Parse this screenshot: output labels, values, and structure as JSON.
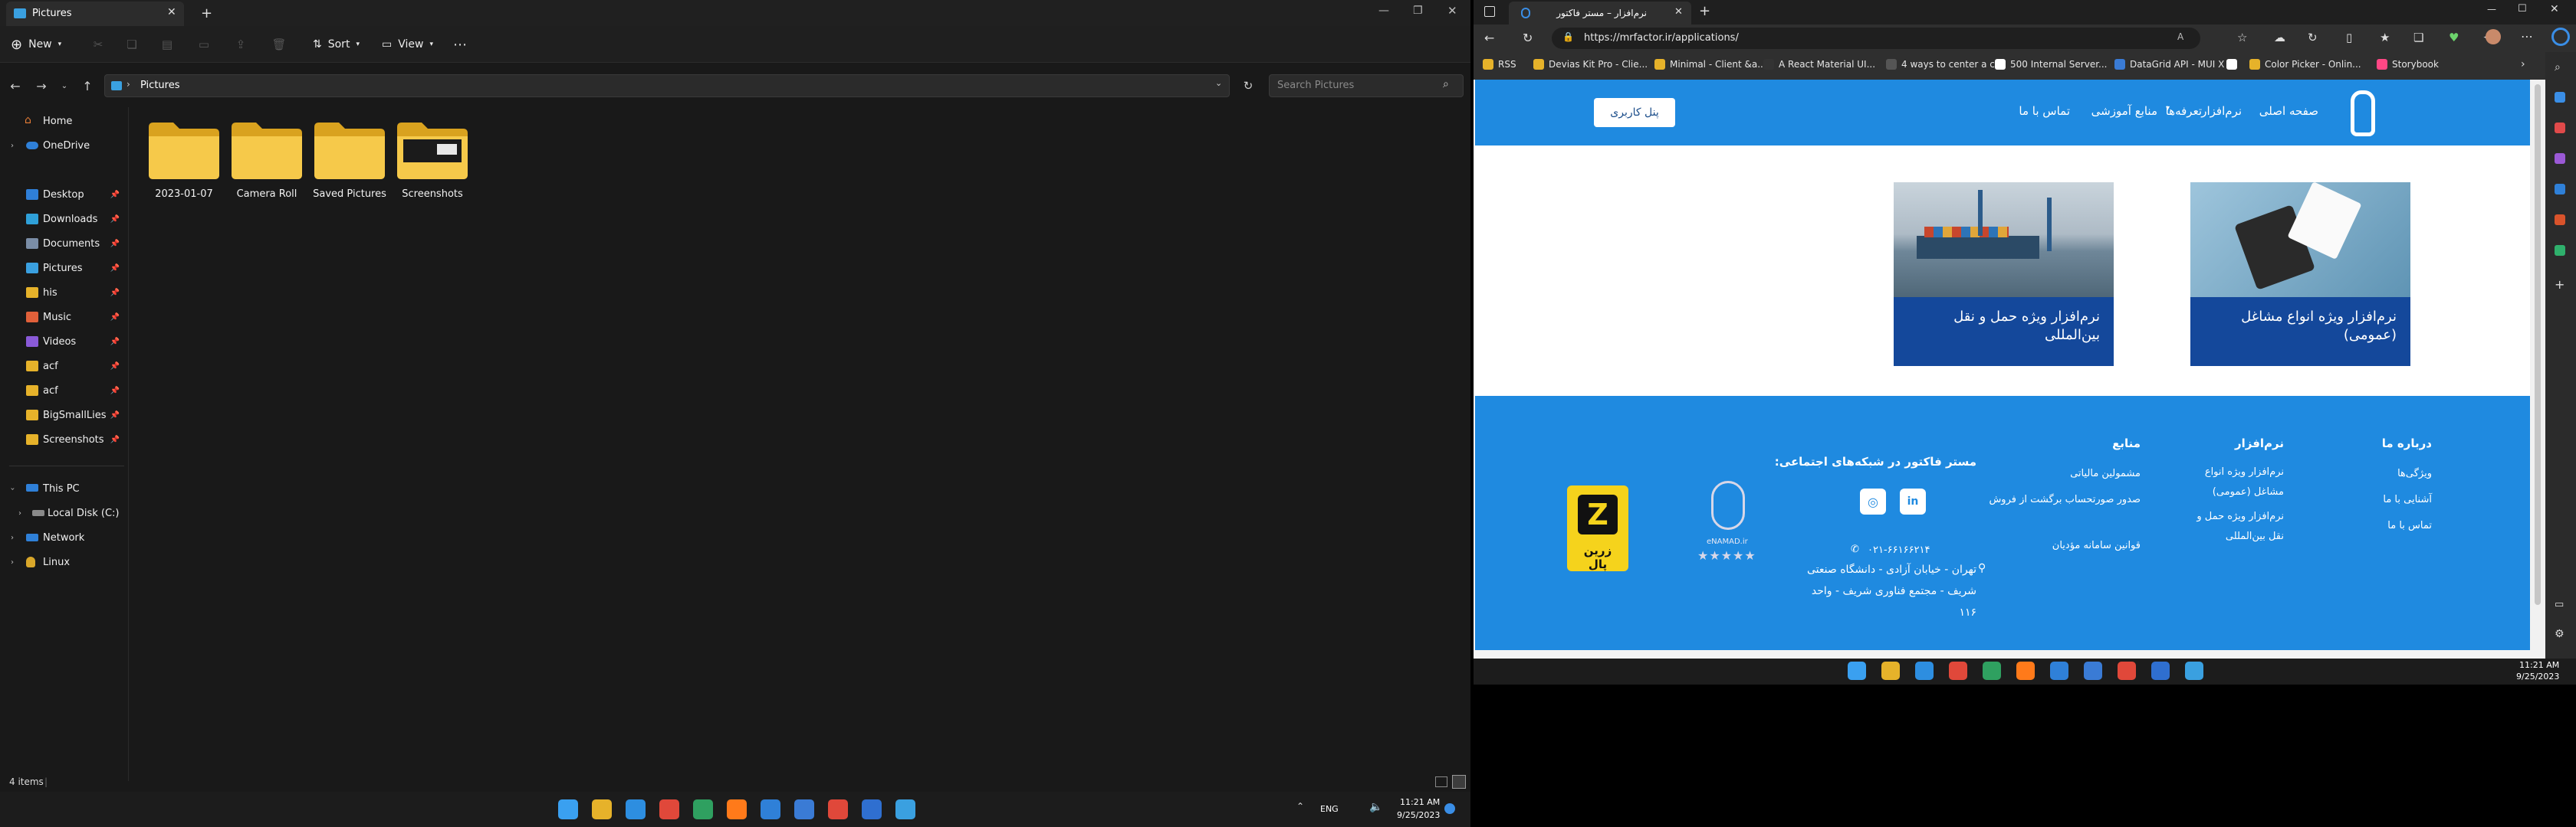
{
  "explorer": {
    "tab_title": "Pictures",
    "toolbar": {
      "new_label": "New",
      "sort_label": "Sort",
      "view_label": "View"
    },
    "address": {
      "path": "Pictures"
    },
    "search": {
      "placeholder": "Search Pictures"
    },
    "nav": {
      "home": "Home",
      "onedrive": "OneDrive",
      "quick": [
        {
          "label": "Desktop",
          "color": "#2f7fd8"
        },
        {
          "label": "Downloads",
          "color": "#2fa0d8"
        },
        {
          "label": "Documents",
          "color": "#7a8da6"
        },
        {
          "label": "Pictures",
          "color": "#3aa0e0"
        },
        {
          "label": "his",
          "color": "#e6b22a"
        },
        {
          "label": "Music",
          "color": "#e0603a"
        },
        {
          "label": "Videos",
          "color": "#8a5ad8"
        },
        {
          "label": "acf",
          "color": "#e6b22a"
        },
        {
          "label": "acf",
          "color": "#e6b22a"
        },
        {
          "label": "BigSmallLies",
          "color": "#e6b22a"
        },
        {
          "label": "Screenshots",
          "color": "#e6b22a"
        }
      ],
      "this_pc": "This PC",
      "local_disk": "Local Disk (C:)",
      "network": "Network",
      "linux": "Linux"
    },
    "folders": [
      "2023-01-07",
      "Camera Roll",
      "Saved Pictures",
      "Screenshots"
    ],
    "status": {
      "items": "4 items",
      "sep": "|"
    }
  },
  "taskbar_left": {
    "lang": "ENG",
    "time": "11:21 AM",
    "date": "9/25/2023"
  },
  "taskbar_right": {
    "time": "11:21 AM",
    "date": "9/25/2023"
  },
  "browser": {
    "tab_title": "نرم‌افزار – مستر فاکتور",
    "url": "https://mrfactor.ir/applications/",
    "bookmarks": [
      {
        "label": "RSS",
        "color": "#e6b22a"
      },
      {
        "label": "Devias Kit Pro - Clie...",
        "color": "#e6b22a"
      },
      {
        "label": "Minimal - Client &a...",
        "color": "#e6b22a"
      },
      {
        "label": "A React Material UI...",
        "color": "#333333"
      },
      {
        "label": "4 ways to center a c...",
        "color": "#555555"
      },
      {
        "label": "500 Internal Server...",
        "color": "#ffffff"
      },
      {
        "label": "DataGrid API - MUI X",
        "color": "#3a7bd5"
      },
      {
        "label": "",
        "color": "#ffffff"
      },
      {
        "label": "Color Picker - Onlin...",
        "color": "#e6b22a"
      },
      {
        "label": "Storybook",
        "color": "#ff4785"
      }
    ],
    "site": {
      "menu": [
        "صفحه اصلی",
        "نرم‌افزار",
        "تعرفه‌ها",
        "منابع آموزشی",
        "تماس با ما"
      ],
      "panel_button": "پنل کاربری",
      "cards": [
        "نرم‌افزار ویژه انواع مشاغل (عمومی)",
        "نرم‌افزار ویژه حمل و نقل بین‌المللی"
      ],
      "footer": {
        "about_title": "درباره ما",
        "about_links": [
          "ویژگی‌ها",
          "آشنایی با ما",
          "تماس با ما"
        ],
        "software_title": "نرم‌افزار",
        "software_links": [
          "نرم‌افزار ویژه انواع مشاغل (عمومی)",
          "نرم‌افزار ویژه حمل و نقل بین‌المللی"
        ],
        "resources_title": "منابع",
        "resources_links": [
          "مشمولین مالیاتی",
          "صدور صورتحساب برگشت از فروش",
          "قوانین سامانه مؤدیان"
        ],
        "social_title": "مستر فاکتور در شبکه‌های اجتماعی:",
        "phone": "۰۲۱-۶۶۱۶۶۲۱۴",
        "address": "تهران - خیابان آزادی - دانشگاه صنعتی شریف - مجتمع فناوری شریف - واحد ۱۱۶",
        "enamad_label": "eNAMAD.ir",
        "zarinpal_label": "زرین پال"
      }
    }
  }
}
